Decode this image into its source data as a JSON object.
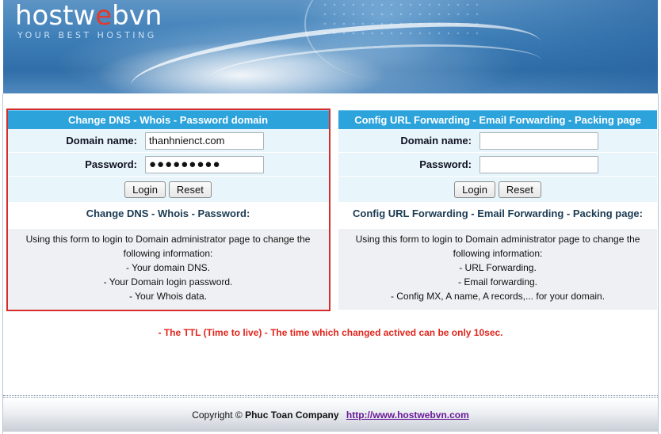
{
  "brand": {
    "logo_prefix": "hostw",
    "logo_e": "e",
    "logo_suffix": "bvn",
    "slogan": "YOUR BEST HOSTING"
  },
  "left_panel": {
    "title": "Change DNS - Whois - Password domain",
    "domain_label": "Domain name:",
    "domain_value": "thanhnienct.com",
    "password_label": "Password:",
    "password_value": "●●●●●●●●●",
    "login_label": "Login",
    "reset_label": "Reset",
    "info_title": "Change DNS - Whois - Password:",
    "info_lines": [
      "Using this form to login to Domain administrator page to change the",
      "following information:",
      "- Your domain DNS.",
      "- Your Domain login password.",
      "- Your Whois data."
    ]
  },
  "right_panel": {
    "title": "Config URL Forwarding - Email Forwarding - Packing page",
    "domain_label": "Domain name:",
    "domain_value": "",
    "password_label": "Password:",
    "password_value": "",
    "login_label": "Login",
    "reset_label": "Reset",
    "info_title": "Config URL Forwarding - Email Forwarding - Packing page:",
    "info_lines": [
      "Using this form to login to Domain administrator page to change the",
      "following information:",
      "- URL Forwarding.",
      "- Email forwarding.",
      "- Config MX, A name, A records,... for your domain."
    ]
  },
  "notice": "- The TTL (Time to live) - The time which changed actived can be only 10sec.",
  "footer": {
    "copyright": "Copyright ©",
    "company": "Phuc Toan Company",
    "link": "http://www.hostwebvn.com"
  },
  "colors": {
    "panel_header": "#2da3dc",
    "form_bg": "#e8f5fb",
    "notice": "#e0251d",
    "highlight_border": "#d62c2c"
  }
}
